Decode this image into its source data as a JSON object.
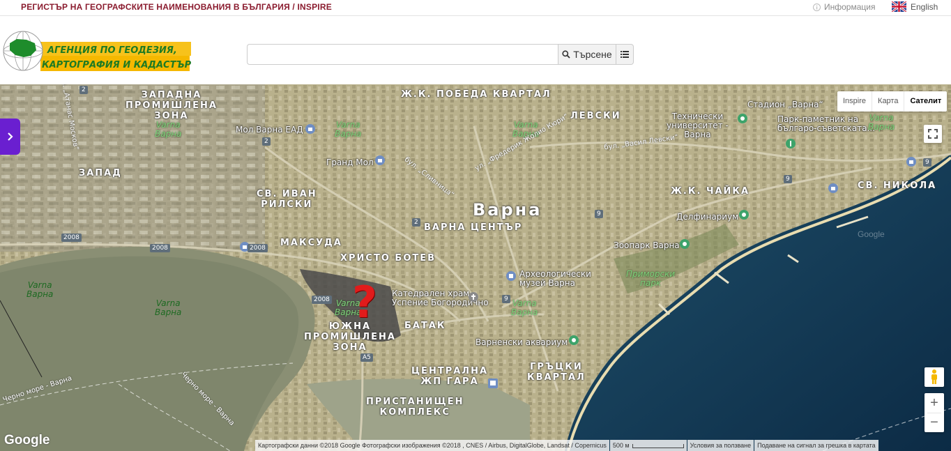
{
  "topbar": {
    "site_title": "РЕГИСТЪР НА ГЕОГРАФСКИТЕ НАИМЕНОВАНИЯ В БЪЛГАРИЯ / INSPIRE",
    "info_label": "Информация",
    "lang_label": "English"
  },
  "header": {
    "logo_line1": "АГЕНЦИЯ ПО ГЕОДЕЗИЯ,",
    "logo_line2": "КАРТОГРАФИЯ И КАДАСТЪР",
    "search": {
      "value": "",
      "placeholder": "",
      "button_label": "Търсене"
    }
  },
  "map": {
    "type_buttons": [
      "Inspire",
      "Карта",
      "Сателит"
    ],
    "active_type": "Сателит",
    "city_label": "Варна",
    "districts": [
      {
        "id": "zapadna-promishlena-zona",
        "text": "ЗАПАДНА\nПРОМИШЛЕНА\nЗОНА"
      },
      {
        "id": "pobeda",
        "text": "Ж.К. ПОБЕДА КВАРТАЛ"
      },
      {
        "id": "levski",
        "text": "ЛЕВСКИ"
      },
      {
        "id": "zapad",
        "text": "ЗАПАД"
      },
      {
        "id": "sv-ivan-rilski",
        "text": "СВ. ИВАН\nРИЛСКИ"
      },
      {
        "id": "chaika",
        "text": "Ж.К. ЧАЙКА"
      },
      {
        "id": "sv-nikola",
        "text": "СВ. НИКОЛА"
      },
      {
        "id": "varna-center",
        "text": "ВАРНА ЦЕНТЪР"
      },
      {
        "id": "maksuda",
        "text": "МАКСУДА"
      },
      {
        "id": "hristo-botev",
        "text": "ХРИСТО БОТЕВ"
      },
      {
        "id": "batak",
        "text": "БАТАК"
      },
      {
        "id": "yuzhna-zona",
        "text": "ЮЖНА\nПРОМИШЛЕНА\nЗОНА"
      },
      {
        "id": "centralna-gara",
        "text": "ЦЕНТРАЛНА\nЖП ГАРА"
      },
      {
        "id": "gratski",
        "text": "ГРЪЦКИ\nКВАРТАЛ"
      },
      {
        "id": "pristanishten",
        "text": "ПРИСТАНИЩЕН\nКОМПЛЕКС"
      }
    ],
    "pois": [
      {
        "id": "mol-varna",
        "text": "Мол Варна ЕАД"
      },
      {
        "id": "grand-mol",
        "text": "Гранд Мол"
      },
      {
        "id": "tech-uni",
        "text": "Технически\nуниверситет -\nВарна"
      },
      {
        "id": "stadium",
        "text": "Стадион „Варна“"
      },
      {
        "id": "park-monument",
        "text": "Парк-паметник на\nбългаро-съветската..."
      },
      {
        "id": "delfinarium",
        "text": "Делфинариум"
      },
      {
        "id": "zoopark",
        "text": "Зоопарк Варна"
      },
      {
        "id": "arch-museum",
        "text": "Археологически\nмузей Варна"
      },
      {
        "id": "primorski",
        "text": "Приморски\nпарк"
      },
      {
        "id": "cathedral",
        "text": "Катедрален храм\nУспение Богородично"
      },
      {
        "id": "aquarium",
        "text": "Варненски аквариум"
      }
    ],
    "green_labels": [
      "Varna\nВарна",
      "Varna\nВарна",
      "Varna\nВарна",
      "Varna\nВарна",
      "Varna\nВарна",
      "Varna\nВарна"
    ],
    "lake_labels": [
      "Varna\nВарна",
      "Varna\nВарна"
    ],
    "roads": [
      "2",
      "2",
      "2",
      "2008",
      "2008",
      "2008",
      "9",
      "9",
      "9",
      "9",
      "A5"
    ],
    "road_names": [
      "бул. „Сливница“",
      "ул. „Фредерик Жолио Кюри“",
      "бул. „Васил Левски“",
      "Черно море - Варна",
      "Черно море - Варна",
      "ул. „Атанас Москов“"
    ],
    "google_label": "Google",
    "sea_google_label": "Google",
    "attribution": {
      "data": "Картографски данни ©2018 Google Фотографски изображения ©2018 , CNES / Airbus, DigitalGlobe, Landsat / Copernicus",
      "scale": "500 м",
      "terms": "Условия за ползване",
      "report": "Подаване на сигнал за грешка в картата"
    },
    "marker_symbol": "?"
  },
  "colors": {
    "title": "#8a1b2e",
    "side_tab": "#6a1fd0",
    "marker": "#e11b1b"
  }
}
